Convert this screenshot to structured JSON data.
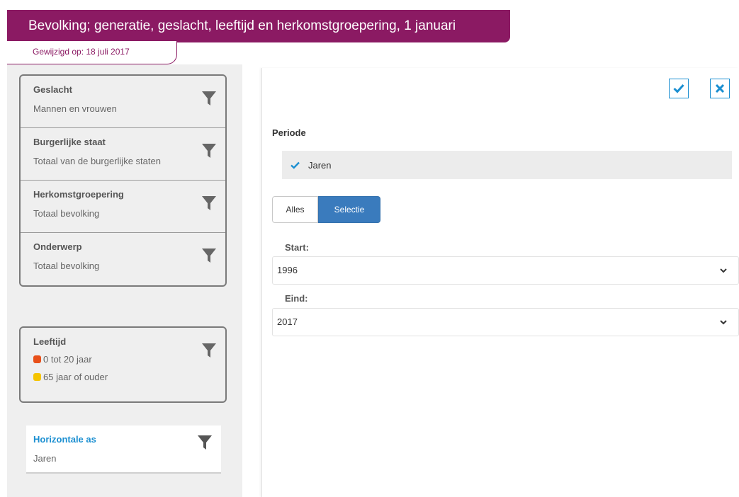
{
  "header": {
    "title": "Bevolking; generatie, geslacht, leeftijd en herkomstgroepering, 1 januari",
    "modified": "Gewijzigd op: 18 juli 2017"
  },
  "sidebar": {
    "filters": [
      {
        "title": "Geslacht",
        "value": "Mannen en vrouwen"
      },
      {
        "title": "Burgerlijke staat",
        "value": "Totaal van de burgerlijke staten"
      },
      {
        "title": "Herkomstgroepering",
        "value": "Totaal bevolking"
      },
      {
        "title": "Onderwerp",
        "value": "Totaal bevolking"
      }
    ],
    "age": {
      "title": "Leeftijd",
      "items": [
        {
          "label": "0 tot 20 jaar",
          "color": "#e8501a"
        },
        {
          "label": "65 jaar of ouder",
          "color": "#f5c400"
        }
      ]
    },
    "axis": {
      "title": "Horizontale as",
      "value": "Jaren"
    },
    "icons": {
      "filter": "filter-icon"
    }
  },
  "panel": {
    "period_label": "Periode",
    "period_value": "Jaren",
    "segment_all": "Alles",
    "segment_selection": "Selectie",
    "start_label": "Start:",
    "start_value": "1996",
    "end_label": "Eind:",
    "end_value": "2017",
    "icons": {
      "confirm": "check-icon",
      "cancel": "close-icon",
      "dropdown": "chevron-down-icon"
    }
  },
  "colors": {
    "brand": "#8b1a63",
    "accent": "#1b8fd1",
    "selected": "#3a7bbd"
  }
}
